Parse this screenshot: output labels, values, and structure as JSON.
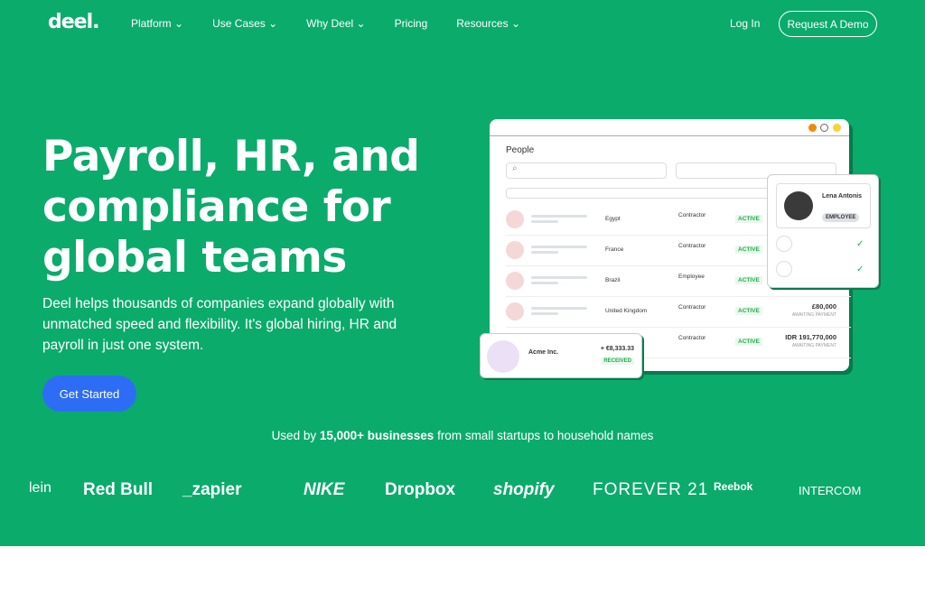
{
  "nav": {
    "logo": "deel.",
    "items": [
      "Platform ⌄",
      "Use Cases ⌄",
      "Why Deel ⌄",
      "Pricing",
      "Resources ⌄"
    ],
    "login": "Log In",
    "demo": "Request A Demo"
  },
  "hero": {
    "title": "Payroll, HR, and compliance for global teams",
    "subtitle": "Deel helps thousands of companies expand globally with unmatched speed and flexibility. It's global hiring, HR and payroll in just one system.",
    "cta": "Get Started"
  },
  "used": {
    "pre": "Used by ",
    "bold": "15,000+ businesses",
    "post": " from small startups to household names"
  },
  "logos": [
    "lein",
    "Red Bull",
    "_zapier",
    "NIKE",
    "Dropbox",
    "shopify",
    "FOREVER 21",
    "Reebok",
    "INTERCOM"
  ],
  "app": {
    "title": "People",
    "rows": [
      {
        "country": "Egypt",
        "type": "Contractor",
        "status": "ACTIVE",
        "amount": "",
        "note": ""
      },
      {
        "country": "France",
        "type": "Contractor",
        "status": "ACTIVE",
        "amount": "",
        "note": ""
      },
      {
        "country": "Brazil",
        "type": "Employee",
        "status": "ACTIVE",
        "amount": "",
        "note": ""
      },
      {
        "country": "United Kingdom",
        "type": "Contractor",
        "status": "ACTIVE",
        "amount": "£80,000",
        "note": "AWAITING PAYMENT"
      },
      {
        "country": "",
        "type": "Contractor",
        "status": "ACTIVE",
        "amount": "IDR 191,770,000",
        "note": "AWAITING PAYMENT"
      }
    ],
    "profile": {
      "name": "Lena Antonis",
      "badge": "EMPLOYEE"
    },
    "payment": {
      "company": "Acme Inc.",
      "amount": "+ €8,333.33",
      "status": "RECEIVED"
    }
  }
}
